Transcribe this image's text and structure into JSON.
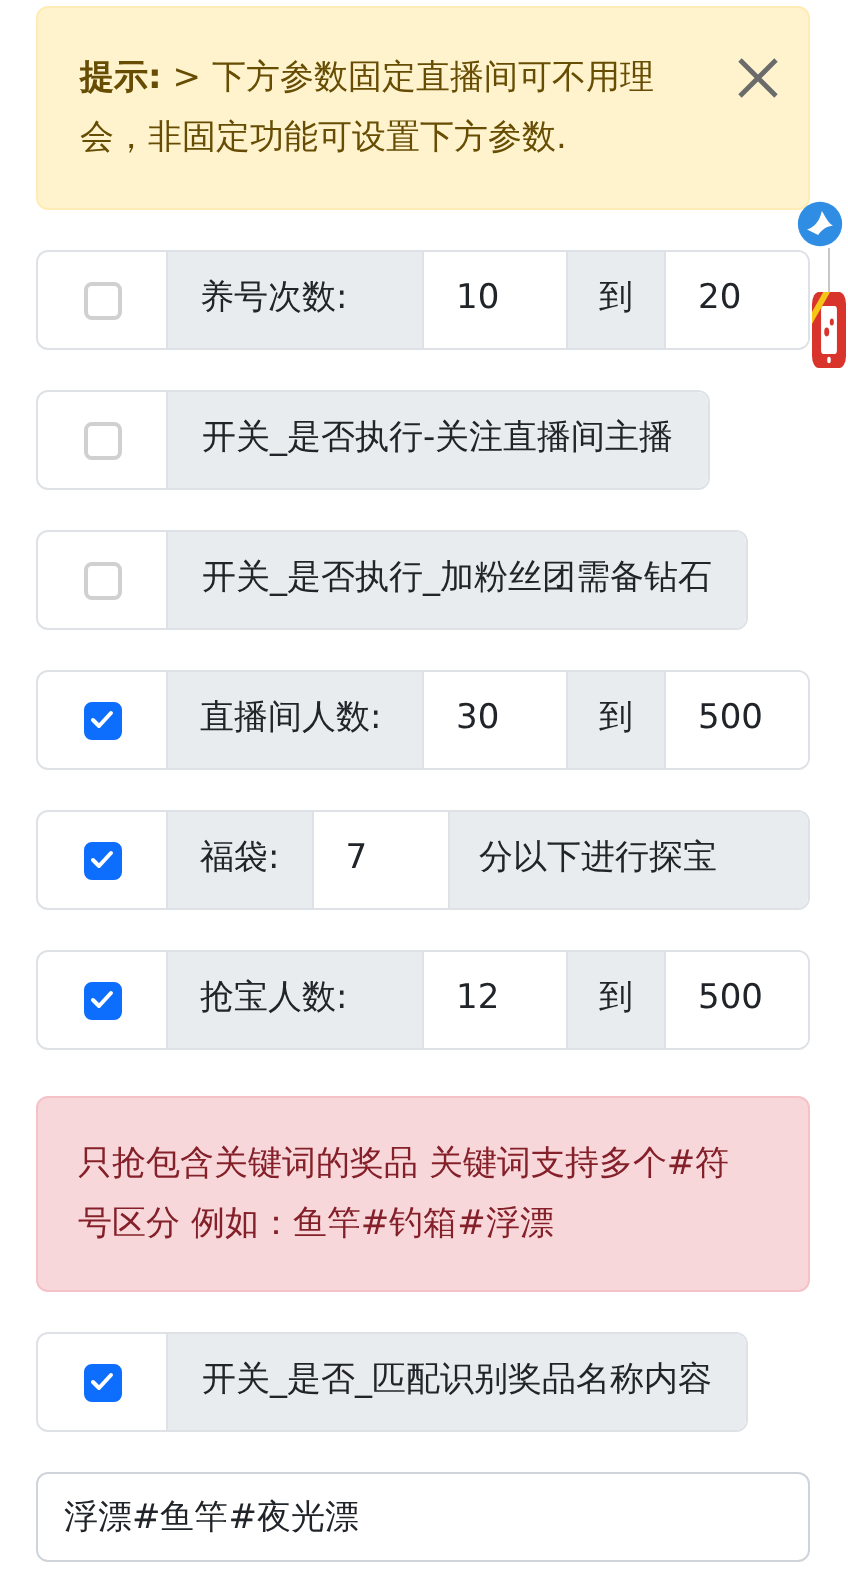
{
  "notice": {
    "title": "提示:",
    "text": "> 下方参数固定直播间可不用理会，非固定功能可设置下方参数."
  },
  "rows": [
    {
      "kind": "range",
      "checked": false,
      "label": "养号次数:",
      "from": "10",
      "sep": "到",
      "to": "20"
    },
    {
      "kind": "toggle",
      "checked": false,
      "label": "开关_是否执行-关注直播间主播"
    },
    {
      "kind": "toggle",
      "checked": false,
      "label": "开关_是否执行_加粉丝团需备钻石"
    },
    {
      "kind": "range",
      "checked": true,
      "label": "直播间人数:",
      "from": "30",
      "sep": "到",
      "to": "500"
    },
    {
      "kind": "suffix",
      "checked": true,
      "label": "福袋:",
      "value": "7",
      "suffix": "分以下进行探宝"
    },
    {
      "kind": "range",
      "checked": true,
      "label": "抢宝人数:",
      "from": "12",
      "sep": "到",
      "to": "500"
    }
  ],
  "warning": "只抢包含关键词的奖品 关键词支持多个#符号区分 例如：鱼竿#钓箱#浮漂",
  "match_row": {
    "kind": "toggle",
    "checked": true,
    "label": "开关_是否_匹配识别奖品名称内容"
  },
  "keywords": {
    "value": "浮漂#鱼竿#夜光漂"
  }
}
